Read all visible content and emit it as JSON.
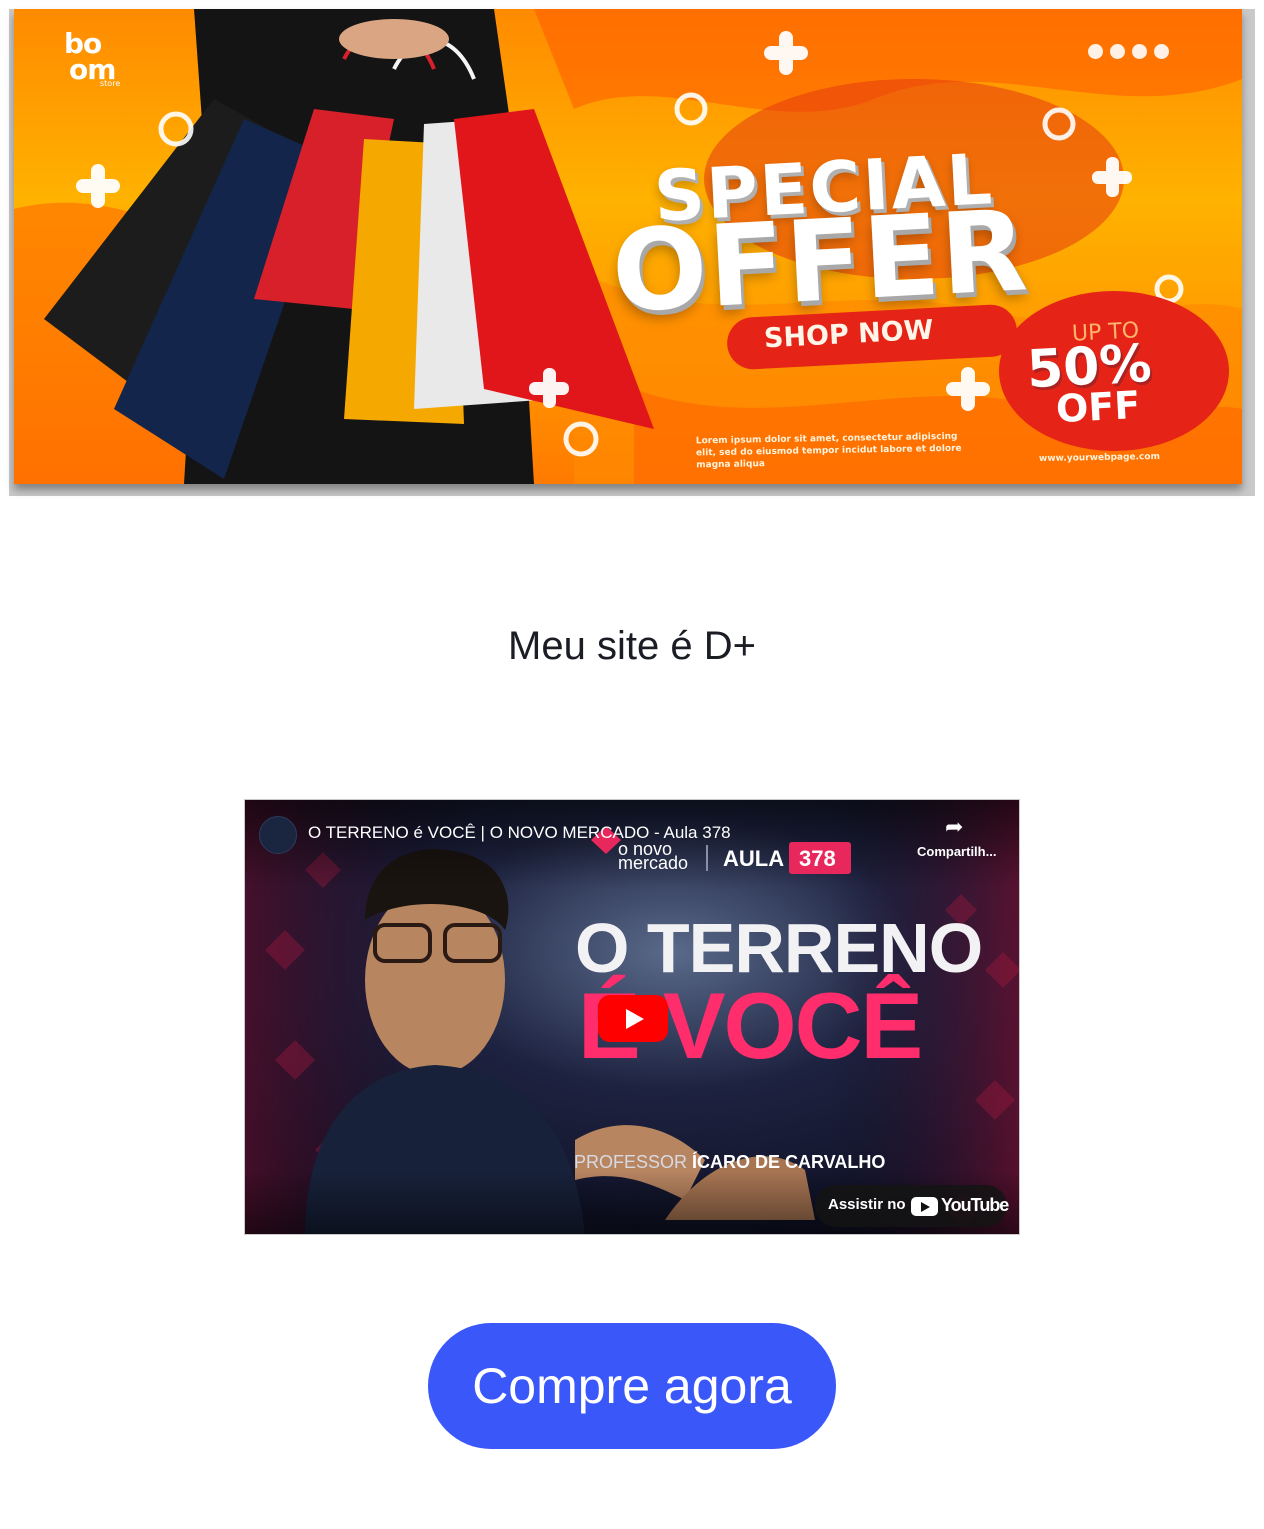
{
  "banner": {
    "logo_line1": "bo",
    "logo_line2": "om",
    "logo_tagline": "store",
    "headline_1": "SPECIAL",
    "headline_2": "OFFER",
    "shop_now": "SHOP NOW",
    "discount_prefix": "UP TO",
    "discount_value": "50%",
    "discount_suffix": "OFF",
    "body_text": "Lorem ipsum dolor sit amet, consectetur adipiscing elit, sed do eiusmod tempor incidut labore et dolore magna aliqua",
    "website": "www.yourwebpage.com",
    "social_icons": [
      "instagram-icon",
      "facebook-icon",
      "youtube-icon",
      "twitter-icon"
    ],
    "colors": {
      "orange": "#ff9a00",
      "red": "#e52417",
      "yellow": "#ffb200"
    }
  },
  "heading": "Meu site é D+",
  "video": {
    "title": "O TERRENO é VOCÊ | O NOVO MERCADO - Aula 378",
    "share_label": "Compartilh...",
    "brand_line1": "o novo",
    "brand_line2": "mercado",
    "aula_label": "AULA",
    "aula_number": "378",
    "thumb_line1": "O TERRENO",
    "thumb_line2": "É VOCÊ",
    "professor_prefix": "PROFESSOR",
    "professor_name": "ÍCARO DE CARVALHO",
    "watch_on": "Assistir no",
    "youtube_word": "YouTube",
    "colors": {
      "pink": "#ff2d6b",
      "navy": "#121429",
      "play_red": "#ff0000"
    }
  },
  "cta": {
    "label": "Compre agora",
    "color": "#3a57fa"
  }
}
